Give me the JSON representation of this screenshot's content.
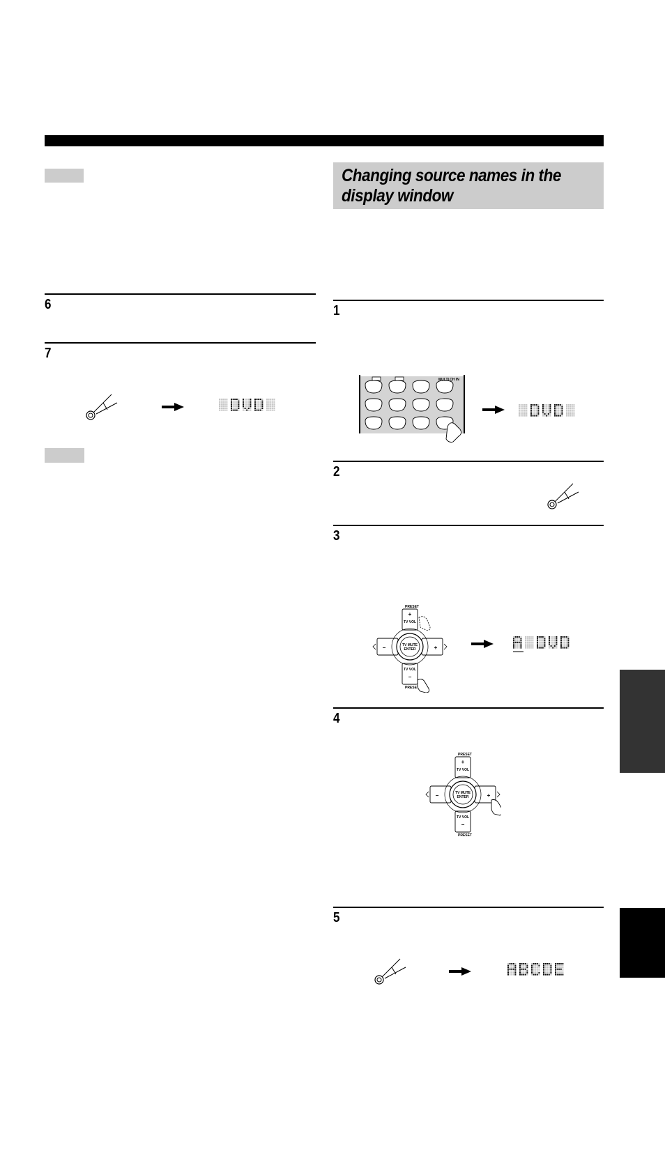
{
  "section": {
    "heading": "Changing source names in the display window"
  },
  "left_column": {
    "steps": [
      {
        "number": "6"
      },
      {
        "number": "7"
      }
    ],
    "step7_illustration": {
      "button_icon": "pen-press-icon",
      "arrow_icon": "arrow-right-icon",
      "display": {
        "text": "DVD",
        "padded": " DVD "
      }
    }
  },
  "right_column": {
    "steps": [
      {
        "number": "1"
      },
      {
        "number": "2"
      },
      {
        "number": "3"
      },
      {
        "number": "4"
      },
      {
        "number": "5"
      }
    ],
    "step1_illustration": {
      "remote_label": "MULTI CH IN",
      "display": {
        "text": "DVD",
        "padded": " DVD "
      }
    },
    "step3_illustration": {
      "preset_up": "PRESET",
      "preset_down": "PRESET",
      "tv_vol_up": "TV VOL",
      "tv_vol_down": "TV VOL",
      "plus": "+",
      "minus": "−",
      "center_line1": "TV MUTE",
      "center_line2": "ENTER",
      "display": {
        "text": "A DVD",
        "cursor_char": "A"
      }
    },
    "step4_illustration": {
      "preset_up": "PRESET",
      "preset_down": "PRESET",
      "tv_vol_up": "TV VOL",
      "tv_vol_down": "TV VOL",
      "plus": "+",
      "minus": "−",
      "center_line1": "TV MUTE",
      "center_line2": "ENTER"
    },
    "step5_illustration": {
      "display": {
        "text": "ABCDE"
      }
    }
  },
  "colors": {
    "gray_box": "#cccccc",
    "side_tab_dark": "#333333",
    "side_tab_black": "#000000",
    "lcd_off": "#c4c4c4",
    "lcd_on": "#111111"
  }
}
